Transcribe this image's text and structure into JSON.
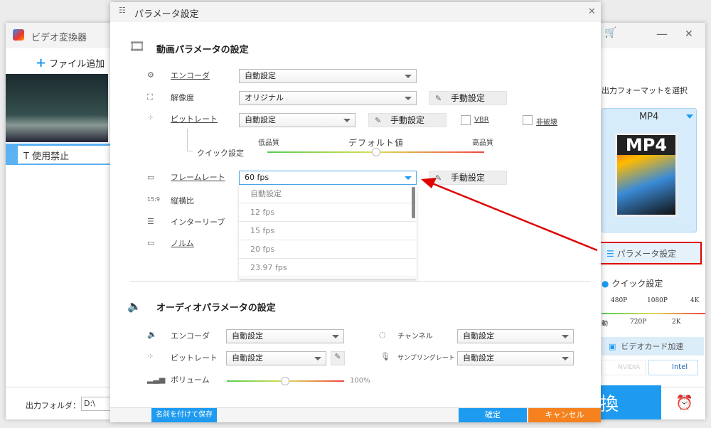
{
  "app": {
    "title": "ビデオ変換器",
    "add_file": "ファイル追加",
    "item_label": "使用禁止",
    "output_folder_label": "出力フォルダ：",
    "output_folder_value": "D:\\",
    "convert_label": "換",
    "format_heading": "出力フォーマットを選択",
    "format": "MP4",
    "param_button": "パラメータ設定",
    "quick_title": "クイック設定",
    "quick_top": [
      "480P",
      "1080P",
      "4K"
    ],
    "quick_bottom": [
      "動",
      "720P",
      "2K"
    ],
    "gpu_label": "ビデオカード加速",
    "nvidia": "NVIDIA",
    "intel": "Intel"
  },
  "dialog": {
    "title": "パラメータ設定",
    "video": {
      "heading": "動画パラメータの設定",
      "encoder_label": "エンコーダ",
      "encoder_value": "自動設定",
      "resolution_label": "解像度",
      "resolution_value": "オリジナル",
      "manual": "手動設定",
      "bitrate_label": "ビットレート",
      "bitrate_value": "自動設定",
      "vbr": "VBR",
      "interlace_cb": "非破壊",
      "quick_label": "クイック設定",
      "low": "低品質",
      "default": "デフォルト値",
      "high": "高品質",
      "quality_level": 0.5,
      "framerate_label": "フレームレート",
      "framerate_value": "60 fps",
      "framerate_options": [
        "自動設定",
        "12 fps",
        "15 fps",
        "20 fps",
        "23.97 fps"
      ],
      "aspect_label": "縦横比",
      "interleave_label": "インターリーブ",
      "norm_label": "ノルム"
    },
    "audio": {
      "heading": "オーディオパラメータの設定",
      "encoder_label": "エンコーダ",
      "encoder_value": "自動設定",
      "bitrate_label": "ビットレート",
      "bitrate_value": "自動設定",
      "volume_label": "ボリューム",
      "volume_value": "100%",
      "channel_label": "チャンネル",
      "channel_value": "自動設定",
      "sample_label": "サンプリングレート",
      "sample_value": "自動設定"
    },
    "save_as": "名前を付けて保存",
    "ok": "確定",
    "cancel": "キャンセル"
  },
  "colors": {
    "accent": "#1e9bf0",
    "cancel": "#f5821f",
    "highlight": "#e00000"
  }
}
